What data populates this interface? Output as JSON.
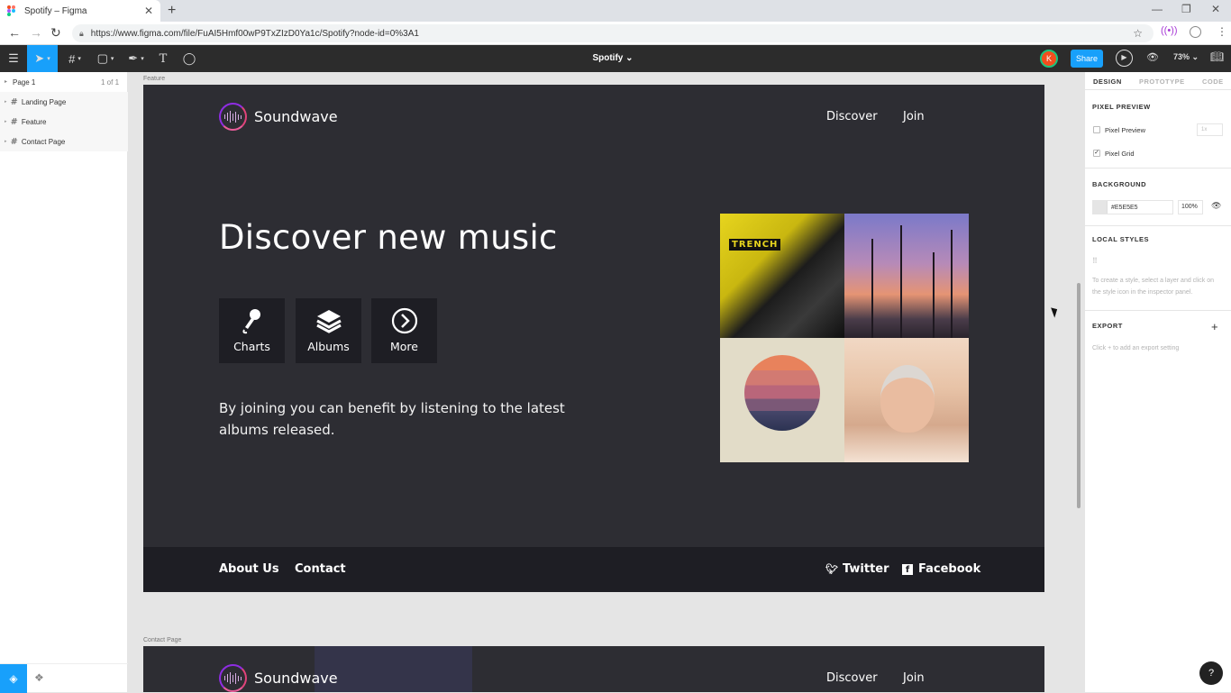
{
  "browser": {
    "tab_title": "Spotify – Figma",
    "tab_close": "✕",
    "new_tab": "+",
    "url": "https://www.figma.com/file/FuAI5Hmf00wP9TxZIzD0Ya1c/Spotify?node-id=0%3A1",
    "window_min": "—",
    "window_restore": "❐",
    "window_close": "✕"
  },
  "toolbar": {
    "file_title": "Spotify ⌄",
    "avatar_initial": "K",
    "share_label": "Share",
    "zoom": "73% ⌄"
  },
  "left_panel": {
    "page_name": "Page 1",
    "page_count": "1 of 1",
    "layers": [
      {
        "label": "Landing Page"
      },
      {
        "label": "Feature"
      },
      {
        "label": "Contact Page"
      }
    ]
  },
  "right_panel": {
    "tabs": [
      "DESIGN",
      "PROTOTYPE",
      "CODE"
    ],
    "pixel_preview_heading": "PIXEL PREVIEW",
    "pixel_preview_label": "Pixel Preview",
    "pixel_preview_select": "1x",
    "pixel_grid_label": "Pixel Grid",
    "background_heading": "BACKGROUND",
    "background_color": "#E5E5E5",
    "background_hex_text": "#E5E5E5",
    "background_opacity": "100%",
    "local_styles_heading": "LOCAL STYLES",
    "local_styles_hint": "To create a style, select a layer and click on the style icon in the inspector panel.",
    "export_heading": "EXPORT",
    "export_hint": "Click + to add an export setting"
  },
  "canvas": {
    "feature_frame_label": "Feature",
    "contact_frame_label": "Contact Page",
    "brand": "Soundwave",
    "nav": [
      "Discover",
      "Join"
    ],
    "headline": "Discover new music",
    "cards": [
      {
        "label": "Charts",
        "icon": "microphone-icon"
      },
      {
        "label": "Albums",
        "icon": "layers-icon"
      },
      {
        "label": "More",
        "icon": "chevron-right-circle-icon"
      }
    ],
    "paragraph": "By joining you can benefit by listening to the latest albums released.",
    "album_trench_label": "TRENCH",
    "footer_links": [
      "About Us",
      "Contact"
    ],
    "social": [
      {
        "label": "Twitter",
        "icon": "twitter-icon"
      },
      {
        "label": "Facebook",
        "icon": "facebook-icon"
      }
    ]
  },
  "colors": {
    "figma_blue": "#18a0fb",
    "frame_bg": "#2d2d33",
    "footer_bg": "#1e1e24",
    "toolbar_bg": "#2c2c2c"
  }
}
